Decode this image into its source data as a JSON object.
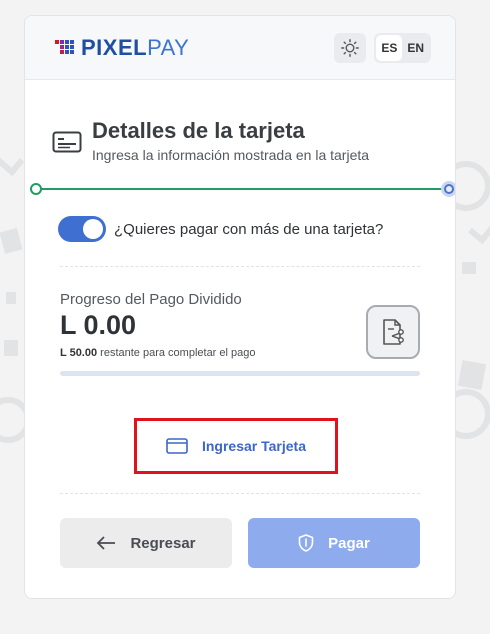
{
  "brand": {
    "logo_bold": "PIXEL",
    "logo_light": "PAY"
  },
  "header": {
    "lang_es": "ES",
    "lang_en": "EN",
    "active_lang": "ES"
  },
  "section": {
    "title": "Detalles de la tarjeta",
    "subtitle": "Ingresa la información mostrada en la tarjeta"
  },
  "split_toggle": {
    "label": "¿Quieres pagar con más de una tarjeta?",
    "enabled": true
  },
  "split_progress": {
    "title": "Progreso del Pago Dividido",
    "amount": "L 0.00",
    "remaining_amount": "L 50.00",
    "remaining_text": "restante para completar el pago",
    "progress_fraction": 0
  },
  "enter_card_label": "Ingresar Tarjeta",
  "actions": {
    "back_label": "Regresar",
    "pay_label": "Pagar"
  },
  "colors": {
    "primary": "#3f6fd1",
    "pay_disabled": "#8eabee",
    "step_done": "#1f9d63",
    "highlight": "#e0121e"
  }
}
